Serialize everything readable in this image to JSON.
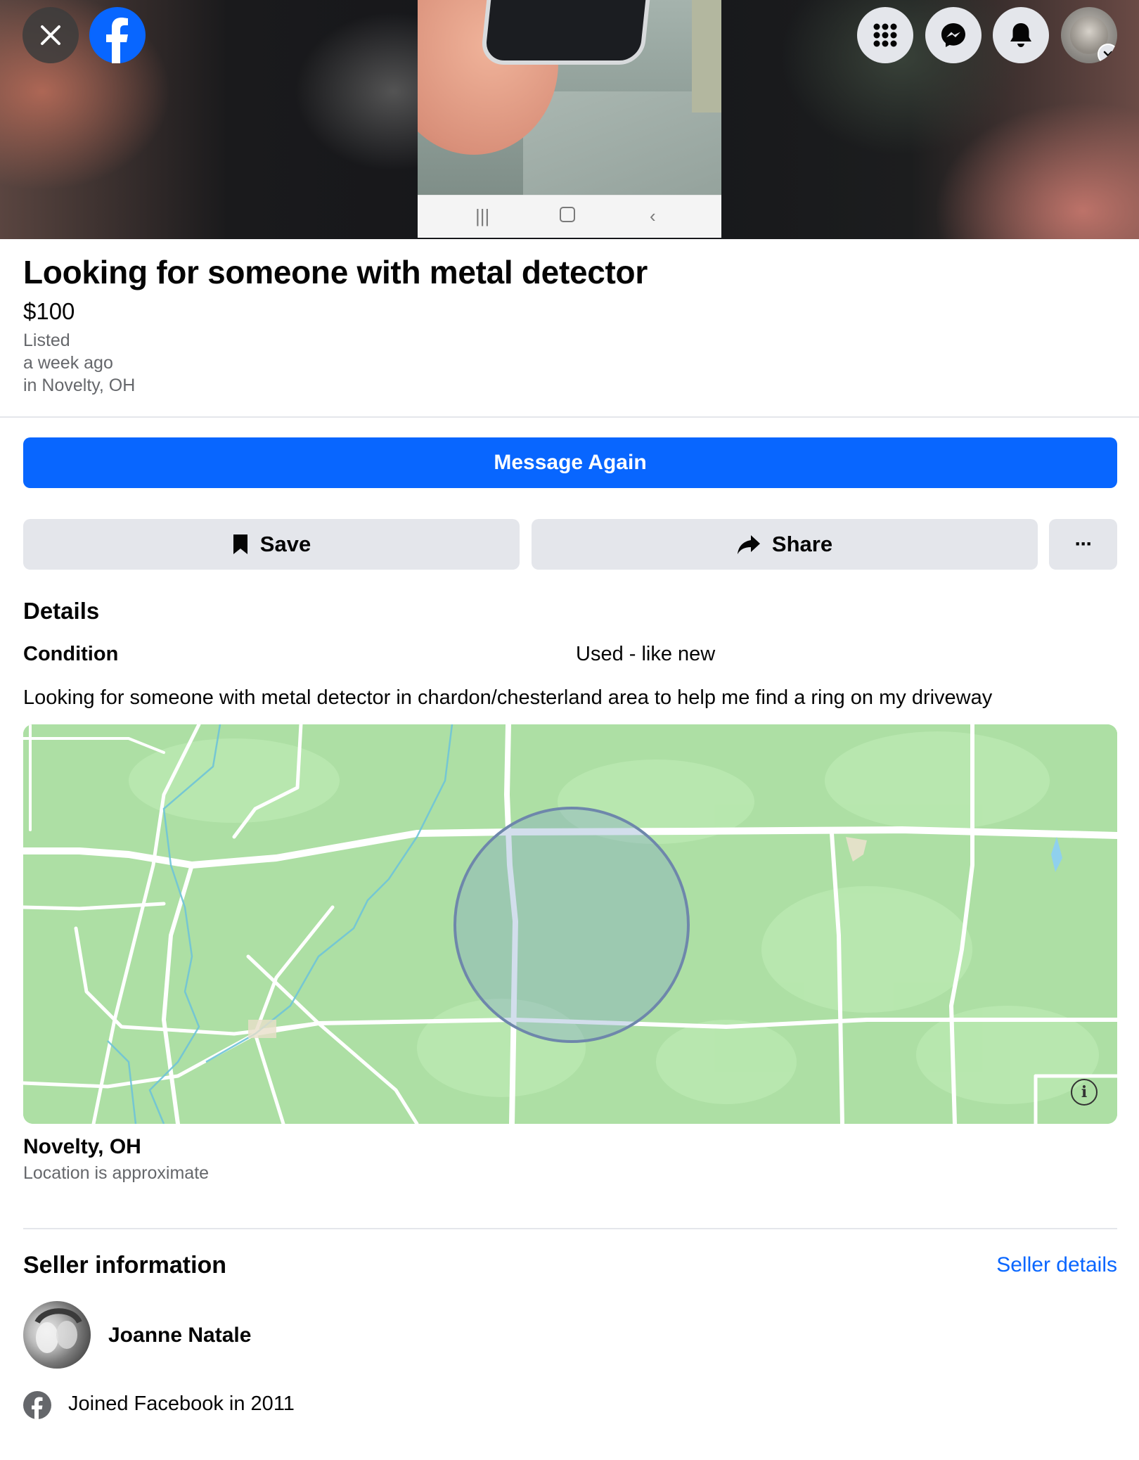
{
  "header": {
    "close_icon": "close-icon",
    "brand_icon": "facebook-logo-icon",
    "menu_icon": "apps-grid-icon",
    "messenger_icon": "messenger-icon",
    "notifications_icon": "bell-icon",
    "account_icon": "profile-avatar"
  },
  "listing": {
    "title": "Looking for someone with metal detector",
    "price": "$100",
    "listed_label": "Listed",
    "listed_time": "a week ago",
    "listed_location": "in Novelty, OH"
  },
  "actions": {
    "message_label": "Message Again",
    "save_label": "Save",
    "share_label": "Share",
    "more_label": "···"
  },
  "details": {
    "heading": "Details",
    "condition_label": "Condition",
    "condition_value": "Used - like new",
    "description": "Looking for someone with metal detector in chardon/chesterland area to help me find a ring on my driveway"
  },
  "location": {
    "title": "Novelty, OH",
    "subtitle": "Location is approximate",
    "info_glyph": "i"
  },
  "seller": {
    "heading": "Seller information",
    "details_link": "Seller details",
    "name": "Joanne Natale",
    "joined": "Joined Facebook in 2011"
  },
  "colors": {
    "brand_blue": "#0866ff",
    "secondary_button": "#e4e6eb",
    "muted_text": "#65676b",
    "map_green": "#a8e0a0"
  }
}
